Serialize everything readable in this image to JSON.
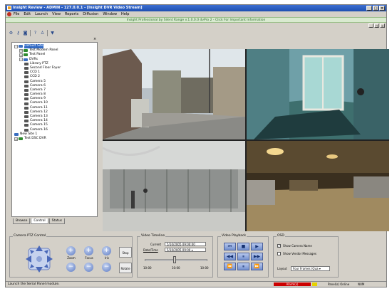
{
  "window": {
    "title": "Insight Review - ADMIN - 127.0.0.1 - [Insight DVR Video Stream]",
    "controls": [
      "_",
      "□",
      "×"
    ]
  },
  "menu": [
    "File",
    "Edit",
    "Launch",
    "View",
    "Reports",
    "Diffusion",
    "Window",
    "Help"
  ],
  "banner": "Insight Professional by Silent Range v.1.0.0.0 dvPro 2 - Click For Important Information",
  "mdi_controls": [
    "_",
    "□",
    "×"
  ],
  "toolbar": {
    "icons": [
      "settings-icon",
      "key-icon",
      "camera-icon",
      "help-icon",
      "user-icon",
      "filter-icon"
    ]
  },
  "tree": {
    "items": [
      {
        "label": "Default Site",
        "level": 0,
        "toggle": "-",
        "icon": "site",
        "selected": true
      },
      {
        "label": "Test Modem Panel",
        "level": 1,
        "toggle": "+",
        "icon": "dvr"
      },
      {
        "label": "Test Panel",
        "level": 1,
        "toggle": "+",
        "icon": "dvr"
      },
      {
        "label": "DVRs",
        "level": 1,
        "toggle": "-",
        "icon": "site"
      },
      {
        "label": "Library PTZ",
        "level": 2,
        "toggle": "",
        "icon": "cam"
      },
      {
        "label": "Second Floor Foyer",
        "level": 2,
        "toggle": "",
        "icon": "cam"
      },
      {
        "label": "CCD 1",
        "level": 2,
        "toggle": "",
        "icon": "cam"
      },
      {
        "label": "CCD 2",
        "level": 2,
        "toggle": "",
        "icon": "cam"
      },
      {
        "label": "Camera 5",
        "level": 2,
        "toggle": "",
        "icon": "cam"
      },
      {
        "label": "Camera 6",
        "level": 2,
        "toggle": "",
        "icon": "cam"
      },
      {
        "label": "Camera 7",
        "level": 2,
        "toggle": "",
        "icon": "cam"
      },
      {
        "label": "Camera 8",
        "level": 2,
        "toggle": "",
        "icon": "cam"
      },
      {
        "label": "Camera 9",
        "level": 2,
        "toggle": "",
        "icon": "cam"
      },
      {
        "label": "Camera 10",
        "level": 2,
        "toggle": "",
        "icon": "cam"
      },
      {
        "label": "Camera 11",
        "level": 2,
        "toggle": "",
        "icon": "cam"
      },
      {
        "label": "Camera 12",
        "level": 2,
        "toggle": "",
        "icon": "cam"
      },
      {
        "label": "Camera 13",
        "level": 2,
        "toggle": "",
        "icon": "cam"
      },
      {
        "label": "Camera 14",
        "level": 2,
        "toggle": "",
        "icon": "cam"
      },
      {
        "label": "Camera 15",
        "level": 2,
        "toggle": "",
        "icon": "cam"
      },
      {
        "label": "Camera 16",
        "level": 2,
        "toggle": "",
        "icon": "cam"
      },
      {
        "label": "New Site 1",
        "level": 0,
        "toggle": "",
        "icon": "site"
      },
      {
        "label": "Test DSC DVR",
        "level": 0,
        "toggle": "+",
        "icon": "dvr"
      }
    ]
  },
  "tabs": [
    "Browse",
    "Control",
    "Status"
  ],
  "video_tiles": [
    "camera-feed-street",
    "camera-feed-entrance",
    "camera-feed-atrium",
    "camera-feed-parking"
  ],
  "ptz": {
    "title": "Camera PTZ Control",
    "zoom": "Zoom",
    "focus": "Focus",
    "iris": "Iris",
    "stop": "Stop",
    "rotate": "Rotate"
  },
  "timeline": {
    "title": "Video Timeline",
    "current_label": "Current",
    "current_value": "5/10/2005 09:00:00",
    "datetime_label": "Date/Time",
    "datetime_value": "5/10/2005 09:00",
    "ticks": [
      "10:00",
      "10:00",
      "10:00"
    ]
  },
  "playback": {
    "title": "Video Playback",
    "buttons": [
      "⏮",
      "■",
      "▶",
      "◀◀",
      "⏸",
      "▶▶",
      "⏪",
      "⏸",
      "⏩"
    ]
  },
  "osd": {
    "title": "OSD",
    "show_camera_name": "Show Camera Name",
    "show_camera_name_checked": true,
    "show_vendor_messages": "Show Vendor Messages",
    "show_vendor_messages_checked": false,
    "layout_label": "Layout",
    "layout_value": "Four Frames (Qua ▾"
  },
  "status": {
    "message": "Launch the Serial Panel module.",
    "alarm": "Alarm(s)",
    "panel_info": "Panel(s) Online",
    "num": "NUM"
  }
}
